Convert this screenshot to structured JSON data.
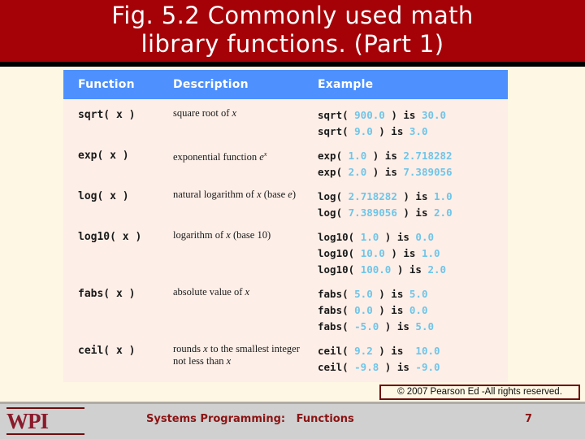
{
  "slide": {
    "title": "Fig. 5.2 Commonly used math\nlibrary functions. (Part 1)",
    "title_band_color": "#a50208",
    "background_color": "#fdf7e3"
  },
  "table": {
    "header_color": "#4d90fe",
    "body_color": "#fdeee7",
    "value_color": "#6fc5e8",
    "columns": [
      "Function",
      "Description",
      "Example"
    ],
    "rows": [
      {
        "function": "sqrt( x )",
        "description_html": "square root of <i>x</i>",
        "examples": [
          "sqrt( <span class=\"num\">900.0</span> ) is <span class=\"num\">30.0</span>",
          "sqrt( <span class=\"num\">9.0</span> ) is <span class=\"num\">3.0</span>"
        ]
      },
      {
        "function": "exp( x )",
        "description_html": "exponential function <i>e</i><sup>x</sup>",
        "examples": [
          "exp( <span class=\"num\">1.0</span> ) is <span class=\"num\">2.718282</span>",
          "exp( <span class=\"num\">2.0</span> ) is <span class=\"num\">7.389056</span>"
        ]
      },
      {
        "function": "log( x )",
        "description_html": "natural logarithm of <i>x</i> (base <i>e</i>)",
        "examples": [
          "log( <span class=\"num\">2.718282</span> ) is <span class=\"num\">1.0</span>",
          "log( <span class=\"num\">7.389056</span> ) is <span class=\"num\">2.0</span>"
        ]
      },
      {
        "function": "log10( x )",
        "description_html": "logarithm of <i>x</i> (base 10)",
        "examples": [
          "log10( <span class=\"num\">1.0</span> ) is <span class=\"num\">0.0</span>",
          "log10( <span class=\"num\">10.0</span> ) is <span class=\"num\">1.0</span>",
          "log10( <span class=\"num\">100.0</span> ) is <span class=\"num\">2.0</span>"
        ]
      },
      {
        "function": "fabs( x )",
        "description_html": "absolute value of <i>x</i>",
        "examples": [
          "fabs( <span class=\"num\">5.0</span> ) is <span class=\"num\">5.0</span>",
          "fabs( <span class=\"num\">0.0</span> ) is <span class=\"num\">0.0</span>",
          "fabs( <span class=\"num\">-5.0</span> ) is <span class=\"num\">5.0</span>"
        ]
      },
      {
        "function": "ceil( x )",
        "description_html": "rounds <i>x</i> to the smallest integer<br>not less than <i>x</i>",
        "examples": [
          "ceil( <span class=\"num\">9.2</span> ) is  <span class=\"num\">10.0</span>",
          "ceil( <span class=\"num\">-9.8</span> ) is <span class=\"num\">-9.0</span>"
        ]
      }
    ]
  },
  "copyright": {
    "text": "© 2007 Pearson Ed -All rights reserved.",
    "border_color": "#6e0d0d"
  },
  "footer": {
    "logo_text": "WPI",
    "logo_color": "#8b1a2b",
    "title": "Systems Programming:   Functions",
    "title_color": "#8b1414",
    "page_number": "7",
    "background_color": "#d0d0d0"
  }
}
